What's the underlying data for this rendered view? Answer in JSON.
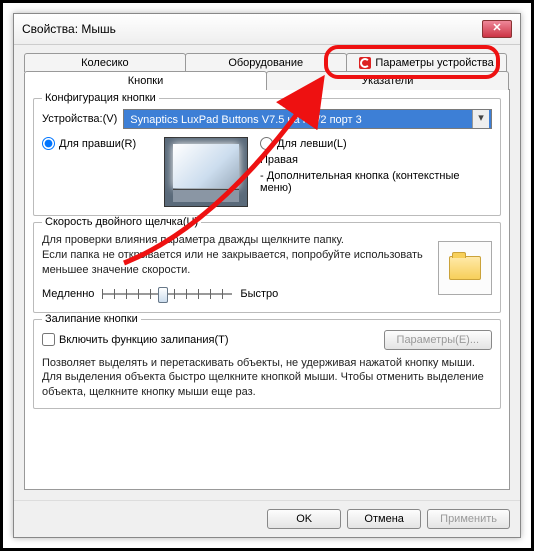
{
  "window": {
    "title": "Свойства: Мышь"
  },
  "tabs": {
    "back": [
      {
        "label": "Колесико"
      },
      {
        "label": "Оборудование"
      },
      {
        "label": "Параметры устройства",
        "icon": true
      }
    ],
    "front": [
      {
        "label": "Кнопки",
        "active": true
      },
      {
        "label": "Указатели"
      }
    ]
  },
  "config": {
    "legend": "Конфигурация кнопки",
    "device_label": "Устройства:(V)",
    "device_value": "Synaptics LuxPad Buttons V7.5 на PS/2 порт 3",
    "radio_right": "Для правши(R)",
    "radio_left": "Для левши(L)",
    "right_hand": "Правая",
    "right_desc": "- Дополнительная кнопка (контекстные меню)"
  },
  "dblclick": {
    "legend": "Скорость двойного щелчка(U)",
    "help1": "Для проверки влияния параметра дважды щелкните папку.",
    "help2": "Если папка не открывается или не закрывается, попробуйте использовать меньшее значение скорости.",
    "slow": "Медленно",
    "fast": "Быстро"
  },
  "sticky": {
    "legend": "Залипание кнопки",
    "checkbox": "Включить функцию залипания(T)",
    "params_btn": "Параметры(E)...",
    "desc": "Позволяет выделять и перетаскивать объекты, не удерживая нажатой кнопку мыши. Для выделения объекта быстро щелкните кнопкой мыши. Чтобы отменить выделение объекта, щелкните кнопку мыши еще раз."
  },
  "buttons": {
    "ok": "OK",
    "cancel": "Отмена",
    "apply": "Применить"
  }
}
